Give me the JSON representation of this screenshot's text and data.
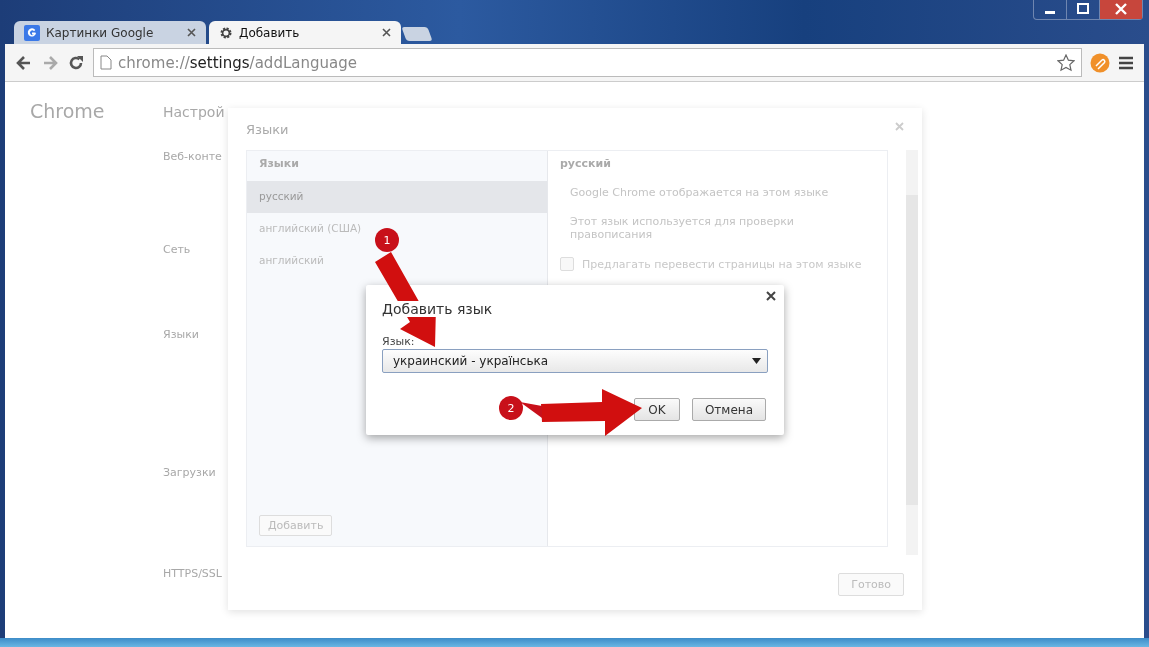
{
  "tabs": [
    {
      "title": "Картинки Google",
      "kind": "google",
      "selected": false
    },
    {
      "title": "Добавить",
      "kind": "settings",
      "selected": true
    }
  ],
  "address_bar": {
    "scheme": "chrome://",
    "host": "settings",
    "path": "/addLanguage"
  },
  "background_page": {
    "sidebar_title": "Chrome",
    "title": "Настрой",
    "sections": [
      "Веб-конте",
      "Сеть",
      "Языки",
      "Загрузки",
      "HTTPS/SSL"
    ]
  },
  "languages_dialog": {
    "title": "Языки",
    "list_header": "Языки",
    "languages": [
      {
        "name": "русский",
        "selected": true
      },
      {
        "name": "английский (США)",
        "selected": false
      },
      {
        "name": "английский",
        "selected": false
      }
    ],
    "add_button": "Добавить",
    "detail": {
      "title": "русский",
      "lines": [
        "Google Chrome отображается на этом языке",
        "Этот язык используется для проверки правописания"
      ],
      "translate_option": {
        "label": "Предлагать перевести страницы на этом языке",
        "checked": false
      }
    },
    "done_button": "Готово"
  },
  "add_language_dialog": {
    "title": "Добавить язык",
    "field_label": "Язык:",
    "value": "украинский - українська",
    "buttons": [
      "OK",
      "Отмена"
    ]
  },
  "annotations": [
    {
      "label": "1"
    },
    {
      "label": "2"
    }
  ]
}
